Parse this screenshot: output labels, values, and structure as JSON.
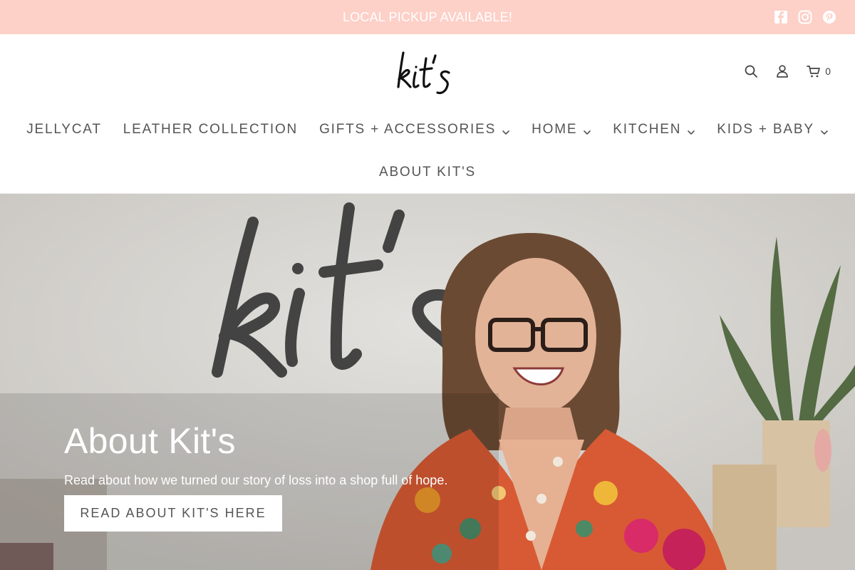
{
  "announcement": {
    "text": "LOCAL PICKUP AVAILABLE!",
    "background": "#fdd0c8"
  },
  "social": [
    "facebook-icon",
    "instagram-icon",
    "pinterest-icon"
  ],
  "header": {
    "logo_text": "kit's",
    "icons": [
      "search-icon",
      "account-icon",
      "cart-icon"
    ],
    "cart_count": "0"
  },
  "nav": {
    "items": [
      {
        "label": "JELLYCAT",
        "has_dropdown": false
      },
      {
        "label": "LEATHER COLLECTION",
        "has_dropdown": false
      },
      {
        "label": "GIFTS + ACCESSORIES",
        "has_dropdown": true
      },
      {
        "label": "HOME",
        "has_dropdown": true
      },
      {
        "label": "KITCHEN",
        "has_dropdown": true
      },
      {
        "label": "KIDS + BABY",
        "has_dropdown": true
      },
      {
        "label": "ABOUT KIT'S",
        "has_dropdown": false
      }
    ]
  },
  "hero": {
    "title": "About Kit's",
    "subtitle": "Read about how we turned our story of loss into a shop full of hope.",
    "button_label": "READ ABOUT KIT'S HERE"
  }
}
